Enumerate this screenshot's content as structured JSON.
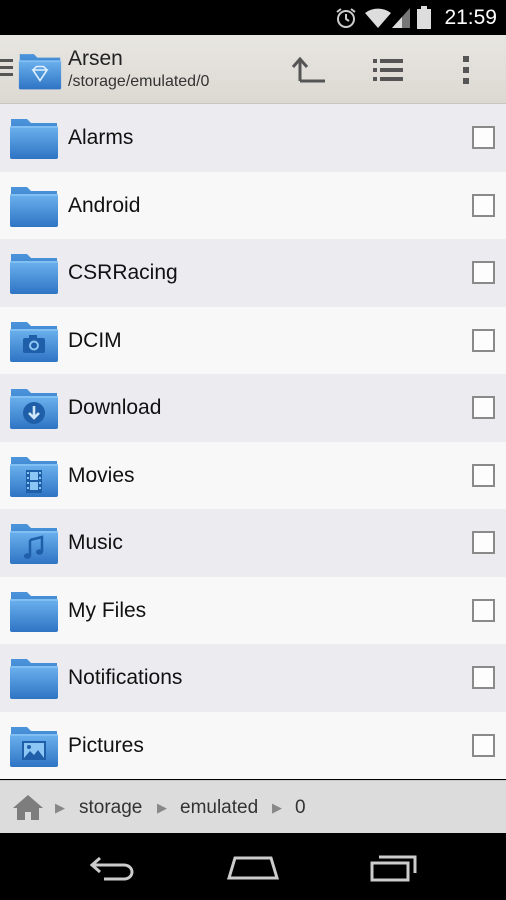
{
  "status_bar": {
    "time": "21:59",
    "icons": [
      "alarm-icon",
      "wifi-icon",
      "signal-icon",
      "battery-icon"
    ]
  },
  "action_bar": {
    "title": "Arsen",
    "subtitle": "/storage/emulated/0",
    "actions": [
      "up-directory-icon",
      "list-view-icon",
      "overflow-menu-icon"
    ]
  },
  "files": [
    {
      "name": "Alarms",
      "icon": "folder-icon",
      "checked": false
    },
    {
      "name": "Android",
      "icon": "folder-icon",
      "checked": false
    },
    {
      "name": "CSRRacing",
      "icon": "folder-icon",
      "checked": false
    },
    {
      "name": "DCIM",
      "icon": "camera-folder-icon",
      "checked": false
    },
    {
      "name": "Download",
      "icon": "download-folder-icon",
      "checked": false
    },
    {
      "name": "Movies",
      "icon": "movies-folder-icon",
      "checked": false
    },
    {
      "name": "Music",
      "icon": "music-folder-icon",
      "checked": false
    },
    {
      "name": "My Files",
      "icon": "folder-icon",
      "checked": false
    },
    {
      "name": "Notifications",
      "icon": "folder-icon",
      "checked": false
    },
    {
      "name": "Pictures",
      "icon": "pictures-folder-icon",
      "checked": false
    }
  ],
  "breadcrumb": {
    "home_icon": "home-icon",
    "items": [
      "storage",
      "emulated",
      "0"
    ]
  },
  "nav_bar": {
    "buttons": [
      "back-icon",
      "home-icon",
      "recent-apps-icon"
    ]
  },
  "colors": {
    "folder_light": "#5aa4e6",
    "folder_dark": "#2f78c8",
    "row_odd": "#ecebf0",
    "row_even": "#f8f8f8",
    "action_bar": "#e4e1dc"
  }
}
